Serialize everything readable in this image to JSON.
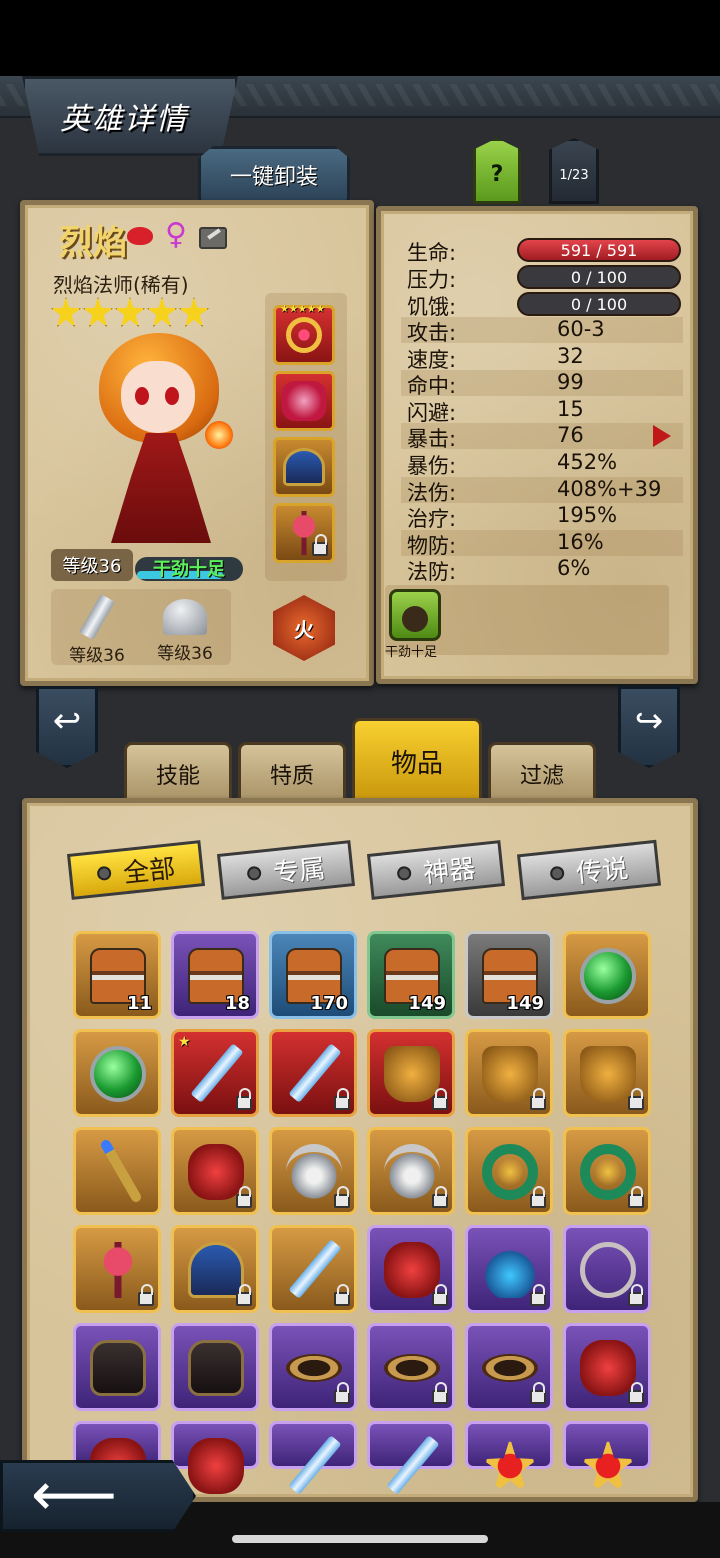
{
  "header": {
    "title": "英雄详情",
    "unequip_label": "一键卸装",
    "help_label": "?",
    "page_indicator": "1/23"
  },
  "hero": {
    "name": "烈焰",
    "gender_symbol": "♀",
    "class": "烈焰法师(稀有)",
    "stars": 5,
    "level_label": "等级36",
    "status": "干劲十足",
    "status_fill": 0.8,
    "element": "火",
    "gear": [
      {
        "name": "weapon",
        "label": "等级36",
        "icon": "sword-icon"
      },
      {
        "name": "armor",
        "label": "等级36",
        "icon": "helmet-icon"
      }
    ],
    "equip_slots": [
      "ring-icon",
      "armor-icon",
      "helmet-icon",
      "axe-icon"
    ],
    "equip_slot_badge": "★★★★★"
  },
  "stats": {
    "hp": {
      "label": "生命:",
      "value": "591 / 591"
    },
    "stress": {
      "label": "压力:",
      "value": "0 / 100"
    },
    "hunger": {
      "label": "饥饿:",
      "value": "0 / 100"
    },
    "rows": [
      {
        "label": "攻击:",
        "value": "60-3"
      },
      {
        "label": "速度:",
        "value": "32"
      },
      {
        "label": "命中:",
        "value": "99"
      },
      {
        "label": "闪避:",
        "value": "15"
      },
      {
        "label": "暴击:",
        "value": "76"
      },
      {
        "label": "暴伤:",
        "value": "452%"
      },
      {
        "label": "法伤:",
        "value": "408%+39"
      },
      {
        "label": "治疗:",
        "value": "195%"
      },
      {
        "label": "物防:",
        "value": "16%"
      },
      {
        "label": "法防:",
        "value": "6%"
      }
    ],
    "trait_label": "干劲十足"
  },
  "nav": {
    "prev_arrow": "↩",
    "next_arrow": "↪"
  },
  "tabs": [
    {
      "label": "技能",
      "active": false
    },
    {
      "label": "特质",
      "active": false
    },
    {
      "label": "物品",
      "active": true
    },
    {
      "label": "过滤",
      "active": false
    }
  ],
  "filters": [
    {
      "label": "全部",
      "active": true
    },
    {
      "label": "专属",
      "active": false
    },
    {
      "label": "神器",
      "active": false
    },
    {
      "label": "传说",
      "active": false
    }
  ],
  "inventory": [
    [
      {
        "icon": "chest-icon",
        "rarity": "orange",
        "count": "11"
      },
      {
        "icon": "chest-icon",
        "rarity": "purple",
        "count": "18"
      },
      {
        "icon": "chest-icon",
        "rarity": "blue",
        "count": "170"
      },
      {
        "icon": "chest-icon",
        "rarity": "green",
        "count": "149"
      },
      {
        "icon": "chest-icon",
        "rarity": "gray",
        "count": "149"
      },
      {
        "icon": "gem-icon",
        "rarity": "orange",
        "count": ""
      }
    ],
    [
      {
        "icon": "gem-icon",
        "rarity": "orange",
        "count": ""
      },
      {
        "icon": "sword-icon",
        "rarity": "red",
        "count": "",
        "lock": true,
        "star": true
      },
      {
        "icon": "sword-icon",
        "rarity": "red",
        "count": "",
        "lock": true
      },
      {
        "icon": "armor-icon",
        "rarity": "red",
        "count": "",
        "lock": true
      },
      {
        "icon": "armor-icon",
        "rarity": "orange",
        "count": "",
        "lock": true
      },
      {
        "icon": "armor-icon",
        "rarity": "orange",
        "count": "",
        "lock": true
      }
    ],
    [
      {
        "icon": "staff-icon",
        "rarity": "orange",
        "count": ""
      },
      {
        "icon": "cloth-icon",
        "rarity": "orange",
        "count": "",
        "lock": true
      },
      {
        "icon": "amulet-icon",
        "rarity": "orange",
        "count": "",
        "lock": true
      },
      {
        "icon": "amulet-icon",
        "rarity": "orange",
        "count": "",
        "lock": true
      },
      {
        "icon": "ring-icon",
        "rarity": "orange",
        "count": "",
        "lock": true
      },
      {
        "icon": "ring-icon",
        "rarity": "orange",
        "count": "",
        "lock": true
      }
    ],
    [
      {
        "icon": "axe-icon",
        "rarity": "orange",
        "count": "",
        "lock": true
      },
      {
        "icon": "helmet-icon",
        "rarity": "orange",
        "count": "",
        "lock": true
      },
      {
        "icon": "sword-icon",
        "rarity": "orange",
        "count": "",
        "lock": true
      },
      {
        "icon": "cloth-icon",
        "rarity": "purple",
        "count": "",
        "lock": true
      },
      {
        "icon": "crown-icon",
        "rarity": "purple",
        "count": "",
        "lock": true
      },
      {
        "icon": "whip-icon",
        "rarity": "purple",
        "count": "",
        "lock": true
      }
    ],
    [
      {
        "icon": "chestplate-icon",
        "rarity": "purple",
        "count": ""
      },
      {
        "icon": "chestplate-icon",
        "rarity": "purple",
        "count": ""
      },
      {
        "icon": "belt-icon",
        "rarity": "purple",
        "count": "",
        "lock": true
      },
      {
        "icon": "belt-icon",
        "rarity": "purple",
        "count": "",
        "lock": true
      },
      {
        "icon": "belt-icon",
        "rarity": "purple",
        "count": "",
        "lock": true
      },
      {
        "icon": "cloth-icon",
        "rarity": "purple",
        "count": "",
        "lock": true
      }
    ],
    [
      {
        "icon": "cloth-icon",
        "rarity": "purple",
        "count": ""
      },
      {
        "icon": "cloth-icon",
        "rarity": "purple",
        "count": ""
      },
      {
        "icon": "sword-icon",
        "rarity": "purple",
        "count": ""
      },
      {
        "icon": "sword-icon",
        "rarity": "purple",
        "count": ""
      },
      {
        "icon": "star-icon",
        "rarity": "purple",
        "count": ""
      },
      {
        "icon": "star-icon",
        "rarity": "purple",
        "count": ""
      }
    ]
  ],
  "footer": {
    "back_arrow": "⟵"
  }
}
